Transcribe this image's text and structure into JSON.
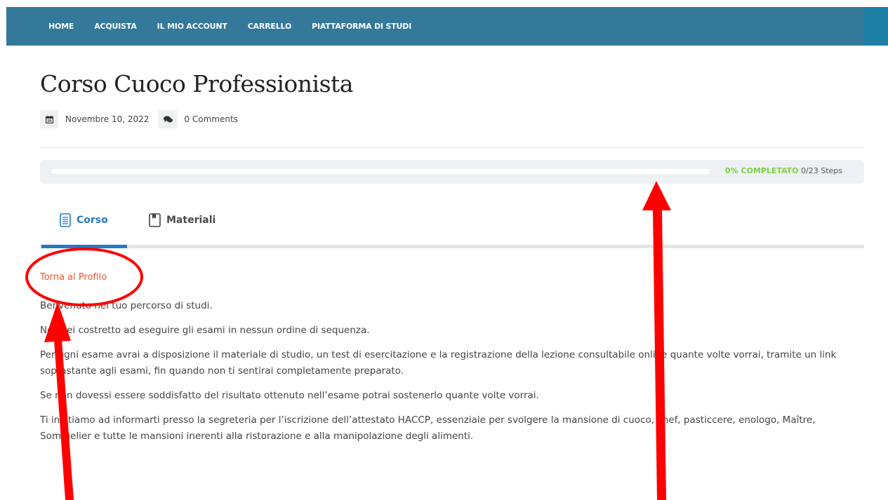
{
  "nav": {
    "items": [
      "HOME",
      "ACQUISTA",
      "IL MIO ACCOUNT",
      "CARRELLO",
      "PIATTAFORMA DI STUDI"
    ]
  },
  "page": {
    "title": "Corso Cuoco Professionista",
    "date": "Novembre 10, 2022",
    "comments": "0 Comments"
  },
  "progress": {
    "percent_label": "0% COMPLETATO",
    "steps_label": "0/23 Steps",
    "completed_fraction": 0
  },
  "tabs": [
    {
      "label": "Corso",
      "icon": "document-icon",
      "active": true
    },
    {
      "label": "Materiali",
      "icon": "bookmark-icon",
      "active": false
    }
  ],
  "content": {
    "back_link": "Torna al Profilo",
    "paragraphs": [
      "Benvenuto nel tuo percorso di studi.",
      "Non sei costretto ad eseguire gli esami in nessun ordine di sequenza.",
      "Per ogni esame avrai a disposizione il materiale di studio, un test di esercitazione e la registrazione della lezione consultabile online quante volte vorrai, tramite un link soprastante agli esami, fin quando non ti sentirai completamente preparato.",
      "Se non dovessi essere soddisfatto del risultato ottenuto nell’esame potrai sostenerlo quante volte vorrai.",
      "Ti invitiamo ad informarti presso la segreteria per l’iscrizione dell’attestato HACCP, essenziale per svolgere la mansione di cuoco, chef, pasticcere, enologo, Maître, Sommelier e tutte le mansioni inerenti alla ristorazione e alla manipolazione degli alimenti."
    ]
  },
  "colors": {
    "nav_bg": "#34789a",
    "accent": "#2879c2",
    "progress_green": "#7bd33c",
    "link": "#e8542e",
    "annotation_red": "#ff0000"
  }
}
